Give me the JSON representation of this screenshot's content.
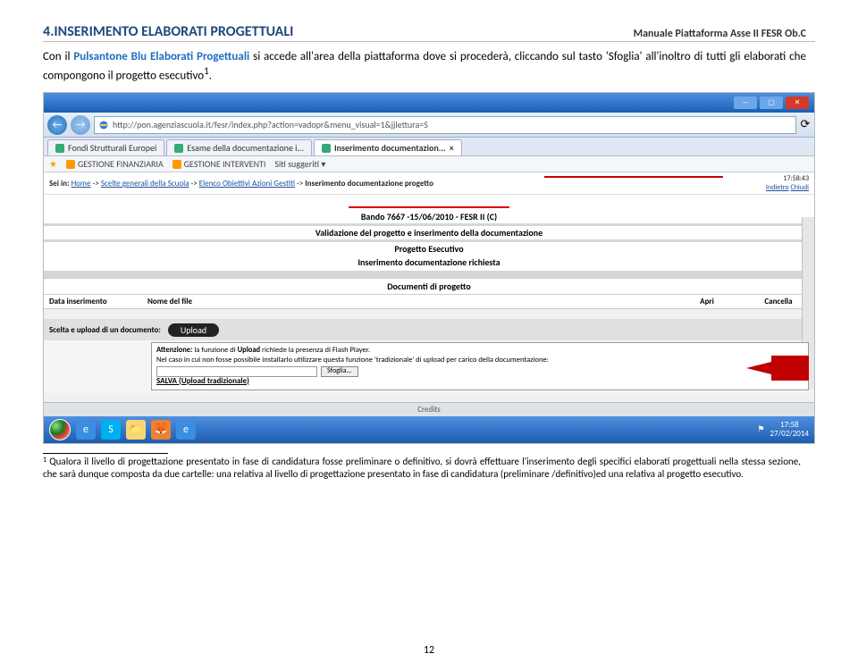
{
  "header": {
    "manual_title": "Manuale Piattaforma Asse II FESR Ob.C"
  },
  "section": {
    "title": "4.INSERIMENTO ELABORATI PROGETTUALI"
  },
  "intro": {
    "pre": "Con il ",
    "blue1": "Pulsantone Blu",
    "mid1": "  ",
    "blue2": "Elaborati Progettuali",
    "post": " si accede all'area della piattaforma dove si procederà, cliccando sul tasto 'Sfoglia' all'inoltro di tutti gli elaborati che compongono il progetto esecutivo",
    "sup": "1",
    "dot": "."
  },
  "browser": {
    "url": "http://pon.agenziascuola.it/fesr/index.php?action=vadopr&menu_visual=1&jjlettura=S",
    "tabs": {
      "t1": "Fondi Strutturali Europei",
      "t2": "Esame della documentazione i...",
      "t3": "Inserimento documentazion...",
      "close": "×"
    },
    "favbar": {
      "a": "GESTIONE FINANZIARIA",
      "b": "GESTIONE INTERVENTI",
      "c": "Siti suggeriti ▾"
    }
  },
  "page": {
    "bc_label": "Sei in:",
    "bc1": "Home",
    "bc2": "Scelte generali della Scuola",
    "bc3": "Elenco Obiettivi Azioni Gestiti",
    "bc_cur": "Inserimento documentazione progetto",
    "time": "17:58:43",
    "back": "Indietro",
    "close": "Chiudi",
    "bando": "Bando 7667 -15/06/2010 - FESR II (C)",
    "valida": "Validazione del progetto e inserimento della documentazione",
    "prog": "Progetto Esecutivo",
    "ins": "Inserimento documentazione richiesta",
    "doctitle": "Documenti di progetto",
    "cols": {
      "a": "Data inserimento",
      "b": "Nome del file",
      "c": "Apri",
      "d": "Cancella"
    },
    "upload_label": "Scelta e upload di un documento:",
    "upload_btn": "Upload",
    "warn_lead": "Attenzione:",
    "warn_l1a": " la funzione di ",
    "warn_l1b": "Upload",
    "warn_l1c": " richiede la presenza di Flash Player.",
    "warn_l2": "Nel caso in cui non fosse possibile installarlo utilizzare questa funzione 'tradizionale' di upload per carico della documentazione:",
    "browse_btn": "Sfoglia...",
    "salva": "SALVA (Upload tradizionale)",
    "credits": "Credits"
  },
  "taskbar": {
    "time": "17:58",
    "date": "27/02/2014"
  },
  "footnote": {
    "sup": "1",
    "text": " Qualora il livello di progettazione presentato in fase di candidatura fosse preliminare o definitivo, si dovrà effettuare l'inserimento degli specifici elaborati progettuali nella stessa sezione, che sarà dunque composta da due cartelle: una relativa al livello di progettazione presentato in fase di candidatura (preliminare /definitivo)ed una relativa al progetto esecutivo."
  },
  "pagenum": "12"
}
